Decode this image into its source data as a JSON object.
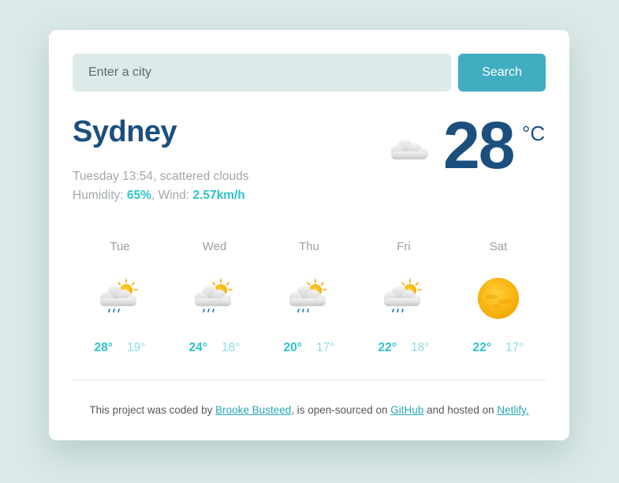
{
  "search": {
    "placeholder": "Enter a city",
    "button_label": "Search"
  },
  "current": {
    "city": "Sydney",
    "description_line": "Tuesday 13:54, scattered clouds",
    "humidity_label": "Humidity: ",
    "humidity_value": "65%",
    "wind_label": ", Wind: ",
    "wind_value": "2.57km/h",
    "temperature": "28",
    "unit": "°C",
    "icon": "scattered-clouds-icon"
  },
  "forecast": [
    {
      "day": "Tue",
      "max": "28°",
      "min": "19°",
      "icon": "sun-cloud-rain-icon"
    },
    {
      "day": "Wed",
      "max": "24°",
      "min": "18°",
      "icon": "sun-cloud-rain-icon"
    },
    {
      "day": "Thu",
      "max": "20°",
      "min": "17°",
      "icon": "sun-cloud-rain-icon"
    },
    {
      "day": "Fri",
      "max": "22°",
      "min": "18°",
      "icon": "sun-cloud-rain-icon"
    },
    {
      "day": "Sat",
      "max": "22°",
      "min": "17°",
      "icon": "sun-icon"
    }
  ],
  "footer": {
    "text_1": "This project was coded by ",
    "link_author": "Brooke Busteed",
    "text_2": ", is open-sourced on ",
    "link_github": "GitHub",
    "text_3": " and hosted on ",
    "link_netlify": "Netlify."
  },
  "colors": {
    "background": "#dbe9e8",
    "primary_text": "#1b4f7d",
    "accent": "#40adc0",
    "highlight": "#2ec4cc"
  }
}
